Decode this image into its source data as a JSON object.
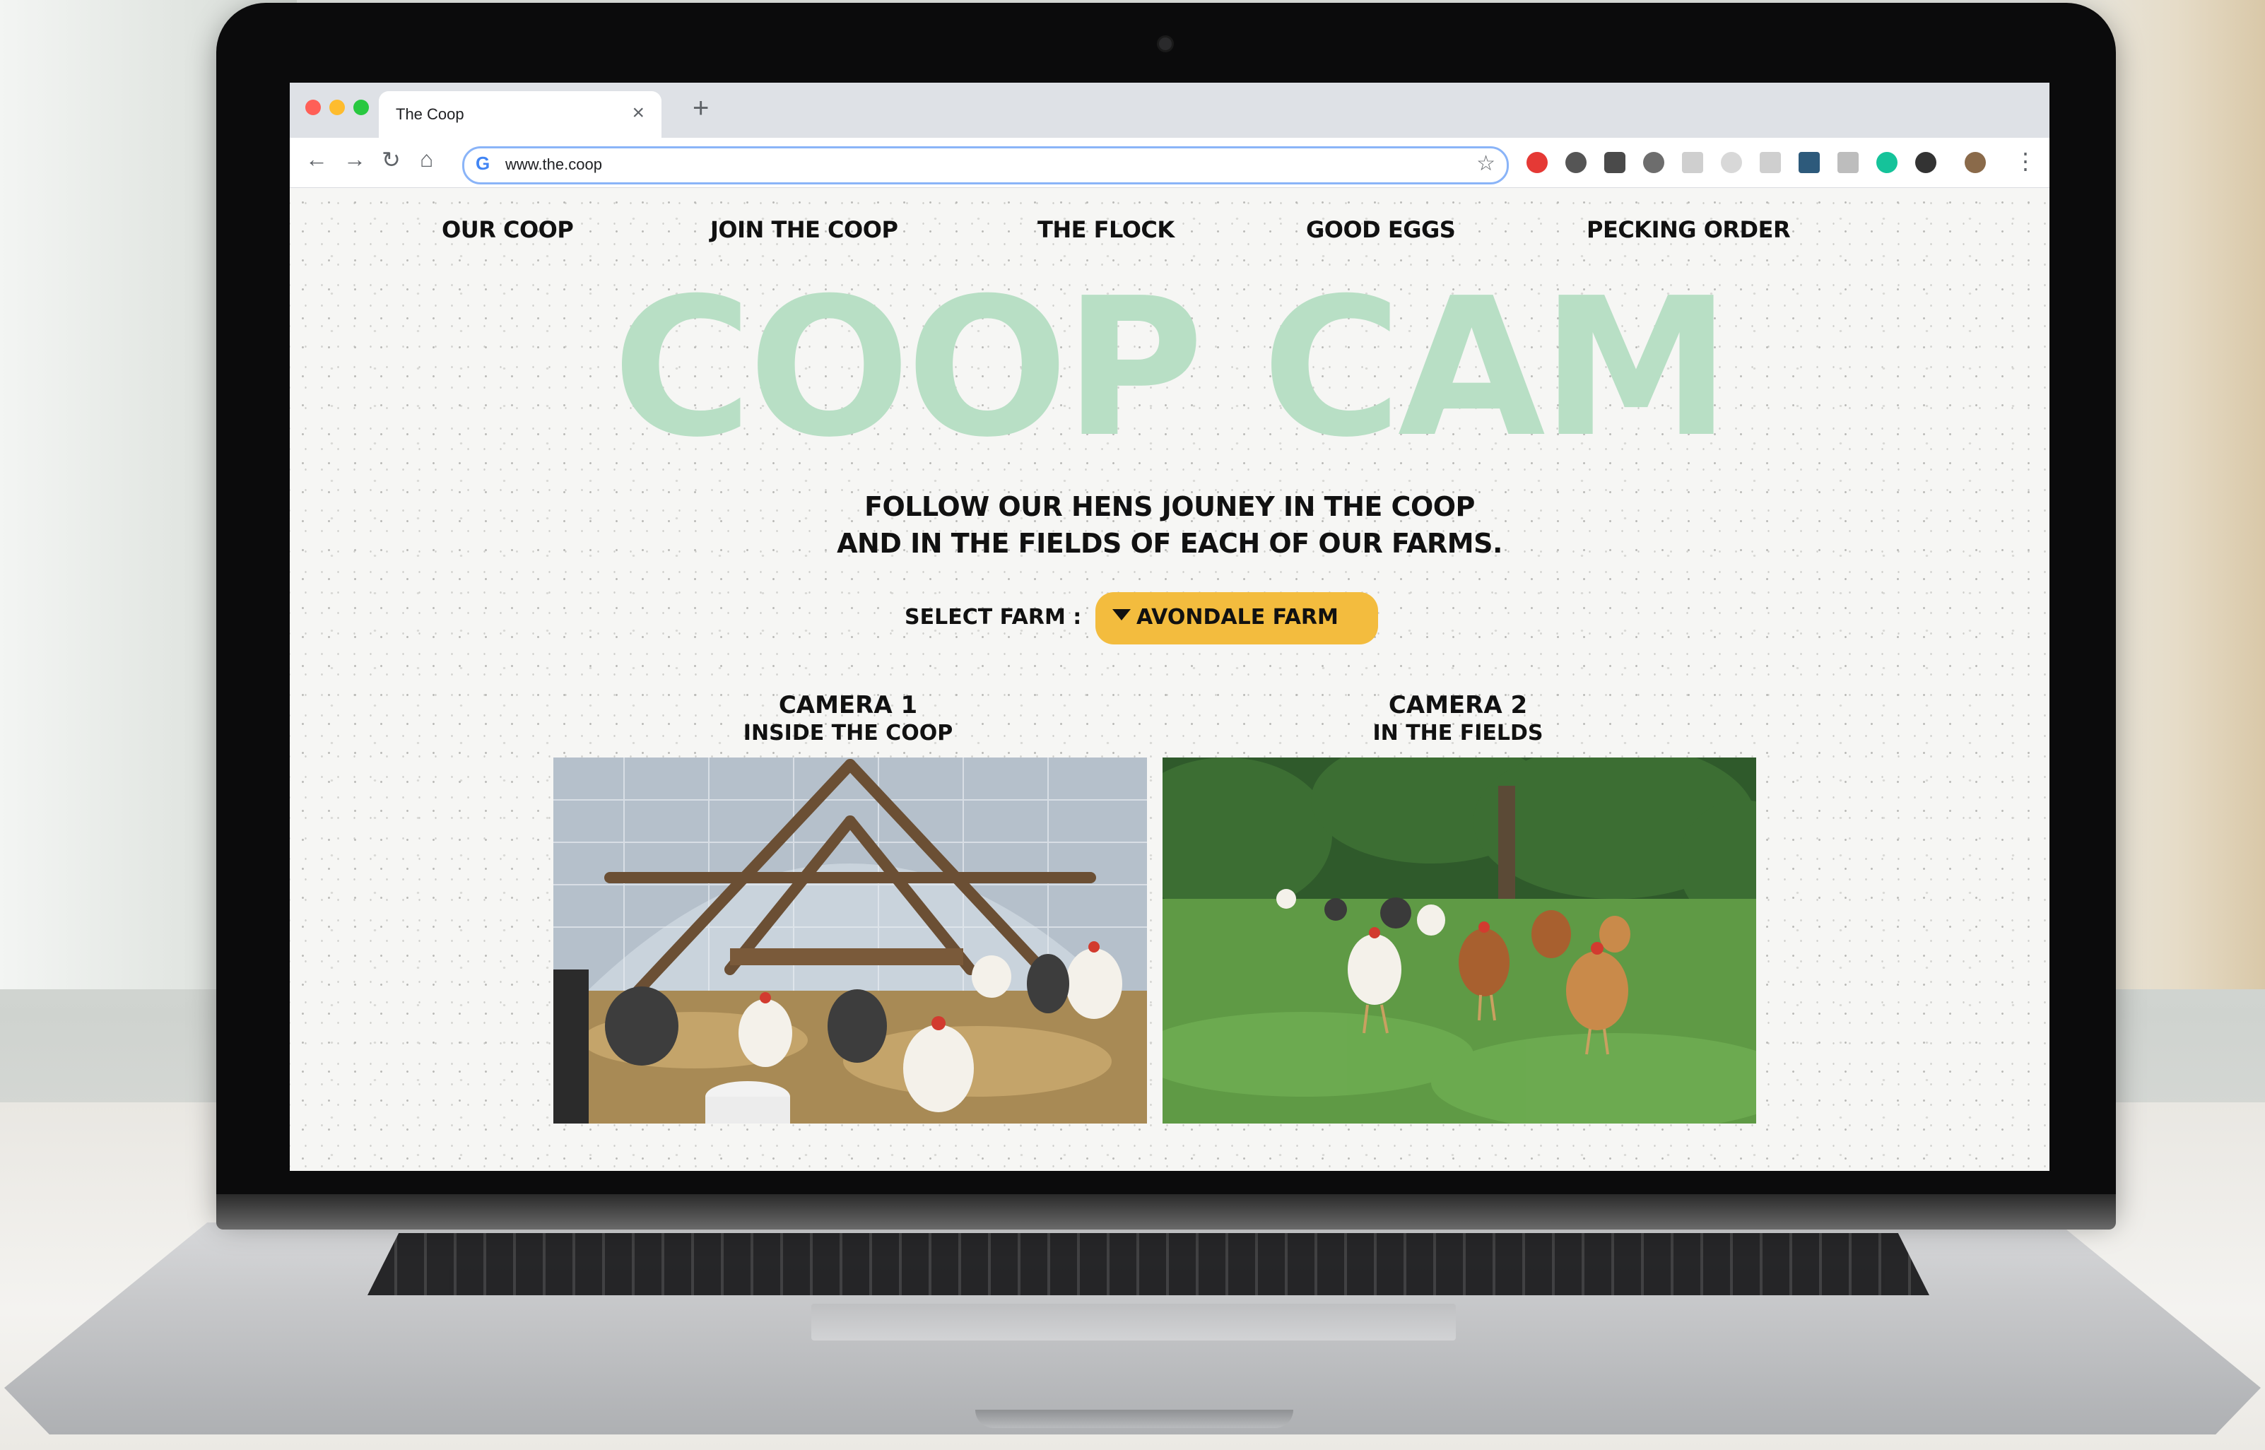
{
  "browser": {
    "tab_title": "The Coop",
    "tab_close_icon": "×",
    "new_tab_icon": "+",
    "url": "www.the.coop"
  },
  "nav": {
    "items": [
      "OUR COOP",
      "JOIN THE COOP",
      "THE FLOCK",
      "GOOD EGGS",
      "PECKING ORDER"
    ]
  },
  "hero": {
    "title": "COOP CAM",
    "subtitle_line1": "FOLLOW OUR HENS JOUNEY IN THE COOP",
    "subtitle_line2": "AND IN THE FIELDS OF EACH OF OUR FARMS."
  },
  "farm_select": {
    "label": "SELECT FARM :",
    "selected": "AVONDALE FARM"
  },
  "cameras": [
    {
      "title": "CAMERA 1",
      "subtitle": "INSIDE THE COOP"
    },
    {
      "title": "CAMERA 2",
      "subtitle": "IN THE FIELDS"
    }
  ],
  "colors": {
    "hero_title": "#b8dfc5",
    "select_button": "#f3bc3e"
  }
}
